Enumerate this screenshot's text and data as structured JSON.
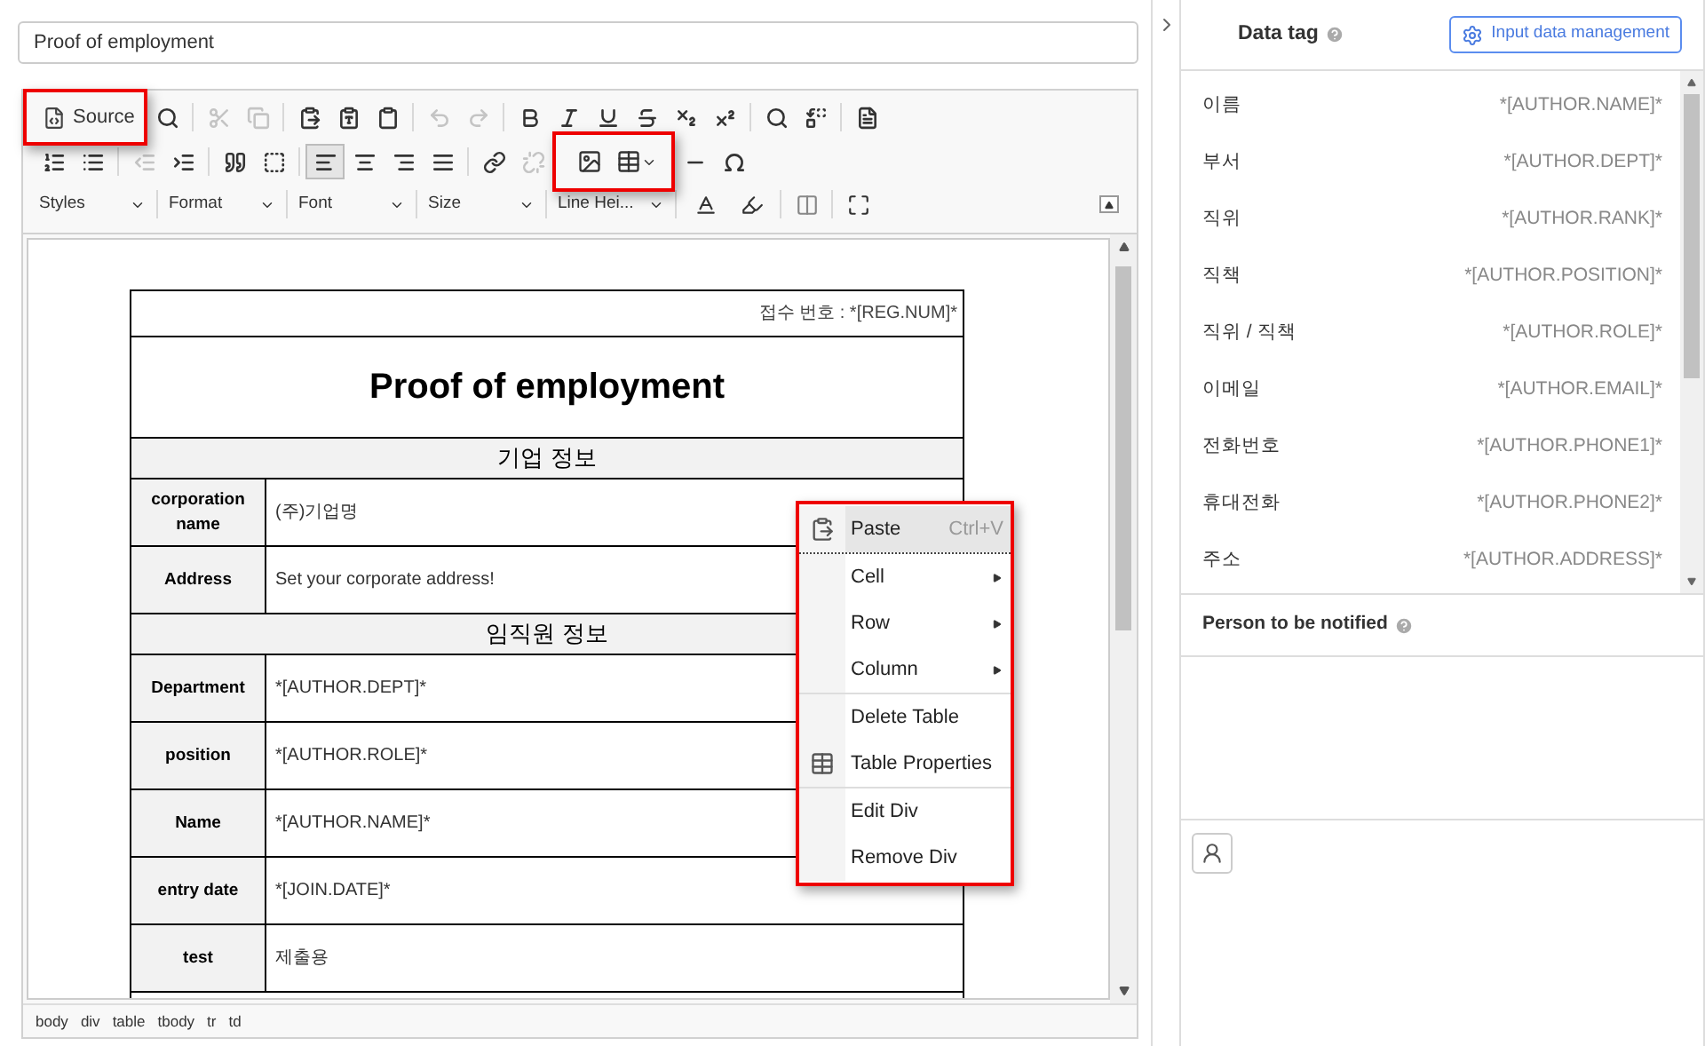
{
  "title_field": {
    "value": "Proof of employment"
  },
  "toolbar": {
    "source": {
      "label": "Source",
      "highlighted": true
    },
    "row1": [
      {
        "kind": "find",
        "disabled": false
      },
      {
        "kind": "cut",
        "disabled": true
      },
      {
        "kind": "copy",
        "disabled": true
      },
      {
        "kind": "paste",
        "disabled": false
      },
      {
        "kind": "paste-text",
        "disabled": false
      },
      {
        "kind": "paste-word",
        "disabled": false
      },
      {
        "kind": "undo",
        "disabled": true
      },
      {
        "kind": "redo",
        "disabled": true
      },
      {
        "kind": "bold",
        "disabled": false
      },
      {
        "kind": "italic",
        "disabled": false
      },
      {
        "kind": "underline",
        "disabled": false
      },
      {
        "kind": "strike",
        "disabled": false
      },
      {
        "kind": "subscript",
        "disabled": false
      },
      {
        "kind": "superscript",
        "disabled": false
      },
      {
        "kind": "search",
        "disabled": false
      },
      {
        "kind": "replace",
        "disabled": false
      },
      {
        "kind": "template",
        "disabled": false
      }
    ],
    "row2": [
      {
        "kind": "numbered-list",
        "disabled": false
      },
      {
        "kind": "bulleted-list",
        "disabled": false
      },
      {
        "kind": "outdent",
        "disabled": true
      },
      {
        "kind": "indent",
        "disabled": false
      },
      {
        "kind": "quote",
        "disabled": false
      },
      {
        "kind": "div",
        "disabled": false
      }
    ],
    "align_buttons": [
      {
        "kind": "left",
        "selected": true
      },
      {
        "kind": "center",
        "selected": false
      },
      {
        "kind": "right",
        "selected": false
      },
      {
        "kind": "justify",
        "selected": false
      }
    ],
    "link_buttons": [
      {
        "kind": "link",
        "disabled": false
      },
      {
        "kind": "unlink",
        "disabled": true
      }
    ],
    "insert_group": {
      "highlighted": true
    },
    "row2_tail": [
      {
        "kind": "rule",
        "disabled": false
      },
      {
        "kind": "omega",
        "disabled": false
      }
    ],
    "dropdowns": [
      {
        "label": "Styles"
      },
      {
        "label": "Format"
      },
      {
        "label": "Font"
      },
      {
        "label": "Size"
      },
      {
        "label": "Line Hei..."
      }
    ]
  },
  "document": {
    "reg_label": "접수 번호 : *[REG.NUM]*",
    "title": "Proof of employment",
    "sections": [
      {
        "heading": "기업 정보",
        "rows": [
          {
            "label": "corporation name",
            "value": "(주)기업명"
          },
          {
            "label": "Address",
            "value": "Set your corporate address!"
          }
        ]
      },
      {
        "heading": "임직원 정보",
        "rows": [
          {
            "label": "Department",
            "value": "*[AUTHOR.DEPT]*"
          },
          {
            "label": "position",
            "value": "*[AUTHOR.ROLE]*"
          },
          {
            "label": "Name",
            "value": "*[AUTHOR.NAME]*"
          },
          {
            "label": "entry date",
            "value": "*[JOIN.DATE]*"
          },
          {
            "label": "test",
            "value": "제출용"
          }
        ]
      }
    ]
  },
  "context_menu": {
    "groups": [
      [
        {
          "label": "Paste",
          "shortcut": "Ctrl+V",
          "kind": "paste",
          "selected": true
        }
      ],
      [
        {
          "label": "Cell",
          "kind": "submenu",
          "selected": false
        },
        {
          "label": "Row",
          "kind": "submenu",
          "selected": false
        },
        {
          "label": "Column",
          "kind": "submenu",
          "selected": false
        }
      ],
      [
        {
          "label": "Delete Table",
          "kind": "plain",
          "selected": false
        },
        {
          "label": "Table Properties",
          "kind": "table",
          "selected": false
        }
      ],
      [
        {
          "label": "Edit Div",
          "kind": "plain",
          "selected": false
        },
        {
          "label": "Remove Div",
          "kind": "plain",
          "selected": false
        }
      ]
    ]
  },
  "path_bar": [
    "body",
    "div",
    "table",
    "tbody",
    "tr",
    "td"
  ],
  "data_tag": {
    "title": "Data tag",
    "button": "Input data management",
    "items": [
      {
        "label": "이름",
        "tag": "*[AUTHOR.NAME]*"
      },
      {
        "label": "부서",
        "tag": "*[AUTHOR.DEPT]*"
      },
      {
        "label": "직위",
        "tag": "*[AUTHOR.RANK]*"
      },
      {
        "label": "직책",
        "tag": "*[AUTHOR.POSITION]*"
      },
      {
        "label": "직위 / 직책",
        "tag": "*[AUTHOR.ROLE]*"
      },
      {
        "label": "이메일",
        "tag": "*[AUTHOR.EMAIL]*"
      },
      {
        "label": "전화번호",
        "tag": "*[AUTHOR.PHONE1]*"
      },
      {
        "label": "휴대전화",
        "tag": "*[AUTHOR.PHONE2]*"
      },
      {
        "label": "주소",
        "tag": "*[AUTHOR.ADDRESS]*"
      }
    ]
  },
  "notify": {
    "title": "Person to be notified"
  }
}
